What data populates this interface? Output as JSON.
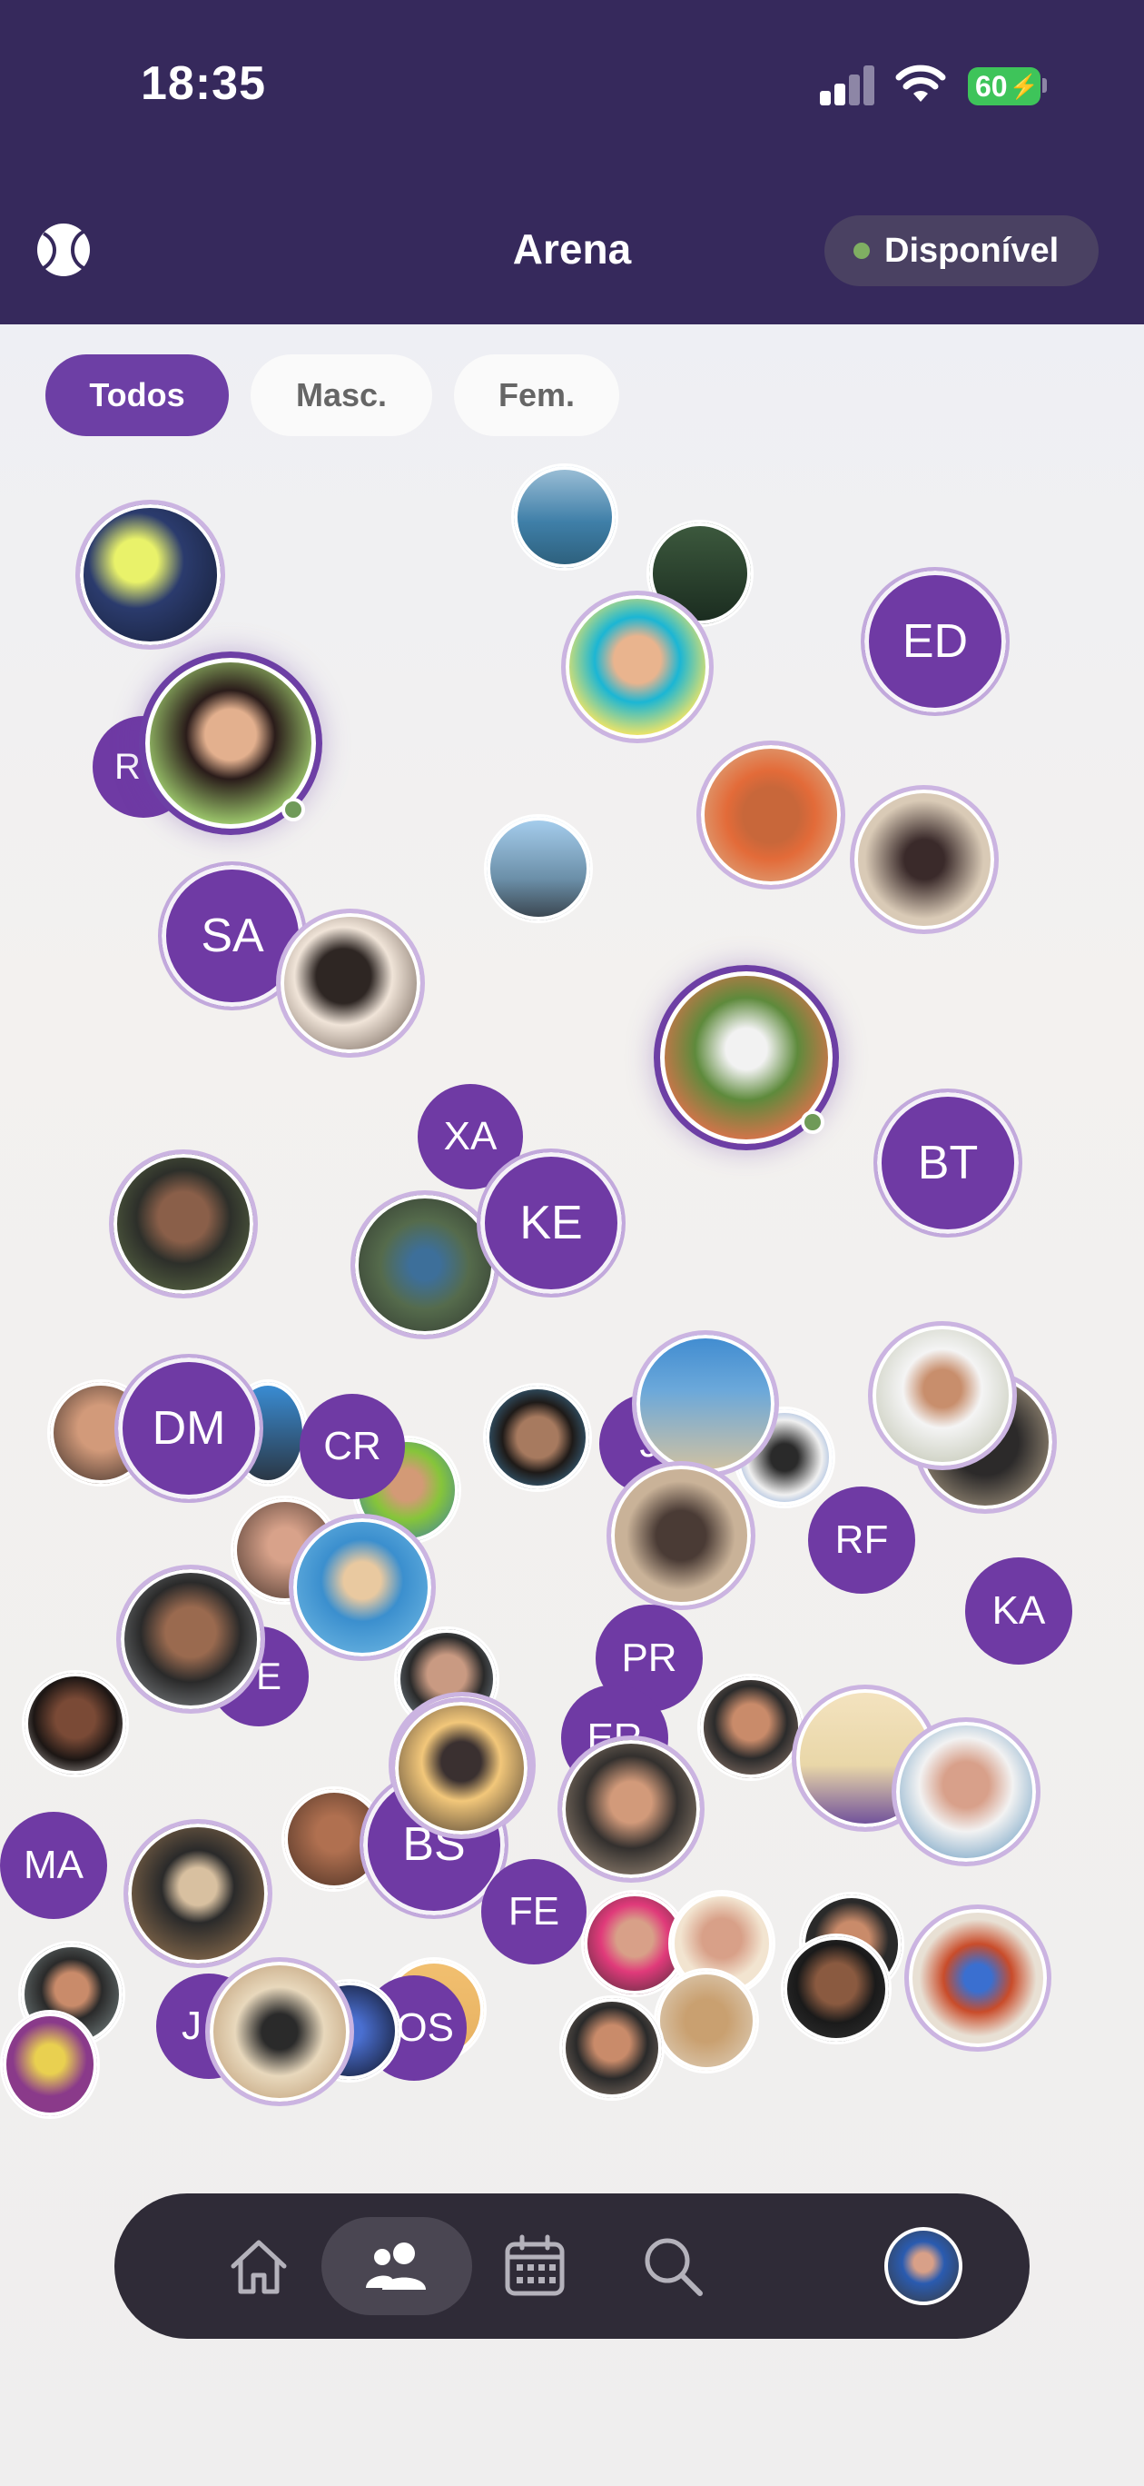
{
  "status_bar": {
    "time": "18:35",
    "battery": "60"
  },
  "header": {
    "title": "Arena",
    "status_label": "Disponível",
    "logo_icon": "tennis-ball-icon"
  },
  "filters": [
    {
      "label": "Todos",
      "active": true
    },
    {
      "label": "Masc.",
      "active": false
    },
    {
      "label": "Fem.",
      "active": false
    }
  ],
  "players": {
    "initials": [
      "ED",
      "R",
      "SA",
      "XA",
      "KE",
      "BT",
      "DM",
      "CR",
      "J",
      "RF",
      "KA",
      "PR",
      "E",
      "ER",
      "MA",
      "BS",
      "FE",
      "J",
      "OS"
    ]
  },
  "nav": [
    {
      "name": "home",
      "icon": "home-icon"
    },
    {
      "name": "players",
      "icon": "people-icon",
      "active": true
    },
    {
      "name": "calendar",
      "icon": "calendar-icon"
    },
    {
      "name": "search",
      "icon": "search-icon"
    },
    {
      "name": "profile",
      "icon": "avatar"
    }
  ],
  "colors": {
    "header": "#36295c",
    "accent": "#6d3fa5",
    "online": "#6f9a58",
    "navbar": "#2f2b37"
  }
}
